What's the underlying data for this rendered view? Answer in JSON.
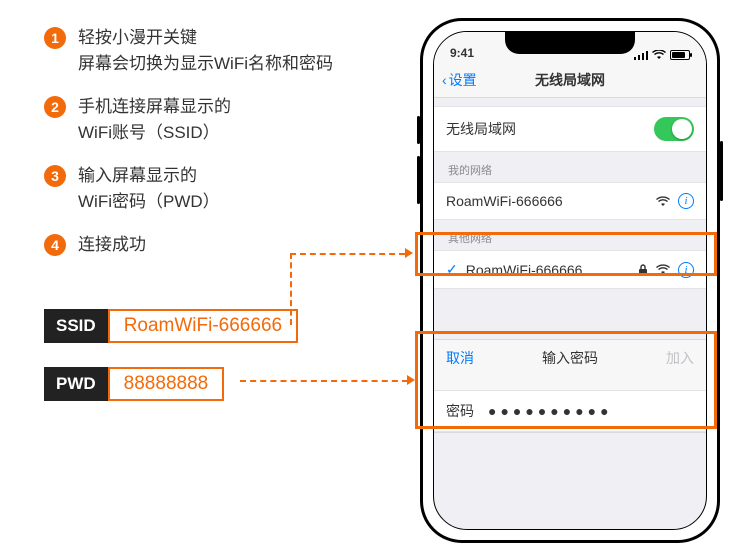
{
  "steps": [
    {
      "num": "1",
      "text": "轻按小漫开关键\n屏幕会切换为显示WiFi名称和密码"
    },
    {
      "num": "2",
      "text": "手机连接屏幕显示的\nWiFi账号（SSID）"
    },
    {
      "num": "3",
      "text": "输入屏幕显示的\nWiFi密码（PWD）"
    },
    {
      "num": "4",
      "text": "连接成功"
    }
  ],
  "creds": {
    "ssid_label": "SSID",
    "ssid_value": "RoamWiFi-666666",
    "pwd_label": "PWD",
    "pwd_value": "88888888"
  },
  "phone": {
    "time": "9:41",
    "nav_back": "设置",
    "nav_title": "无线局域网",
    "wifi_toggle_label": "无线局域网",
    "my_networks_label": "我的网络",
    "my_network_name": "RoamWiFi-666666",
    "other_networks_label": "其他网络",
    "selected_network_name": "RoamWiFi-666666",
    "pwd_dialog": {
      "cancel": "取消",
      "title": "输入密码",
      "join": "加入",
      "field_label": "密码",
      "masked": "●●●●●●●●●●"
    }
  }
}
